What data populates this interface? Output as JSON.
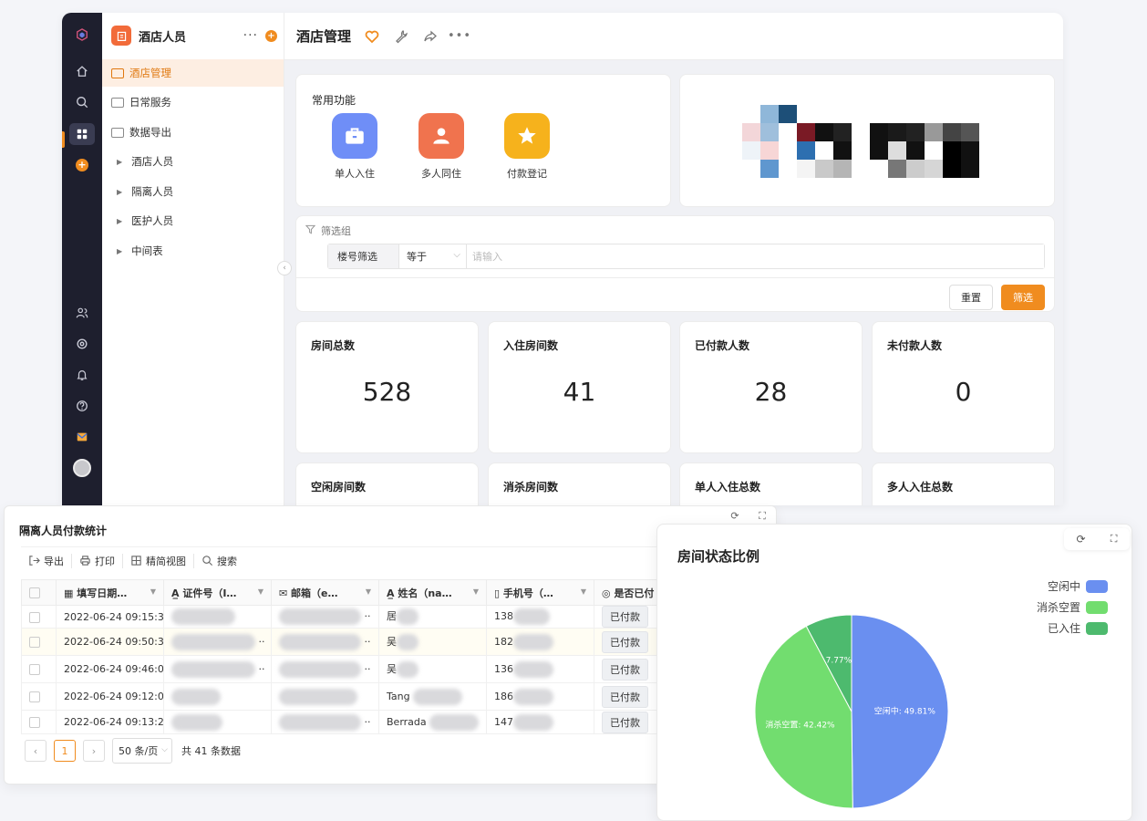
{
  "sidebar": {
    "title": "酒店人员",
    "items": [
      {
        "label": "酒店管理"
      },
      {
        "label": "日常服务"
      },
      {
        "label": "数据导出"
      },
      {
        "label": "酒店人员"
      },
      {
        "label": "隔离人员"
      },
      {
        "label": "医护人员"
      },
      {
        "label": "中间表"
      }
    ]
  },
  "header": {
    "title": "酒店管理"
  },
  "common": {
    "title": "常用功能",
    "items": [
      {
        "label": "单人入住",
        "icon": "briefcase-icon",
        "color": "#6f8ef7"
      },
      {
        "label": "多人同住",
        "icon": "person-icon",
        "color": "#f0734e"
      },
      {
        "label": "付款登记",
        "icon": "star-icon",
        "color": "#f6b21c"
      }
    ]
  },
  "filter": {
    "group_label": "筛选组",
    "field": "楼号筛选",
    "operator": "等于",
    "placeholder": "请输入",
    "reset_label": "重置",
    "submit_label": "筛选"
  },
  "stats": [
    {
      "label": "房间总数",
      "value": "528"
    },
    {
      "label": "入住房间数",
      "value": "41"
    },
    {
      "label": "已付款人数",
      "value": "28"
    },
    {
      "label": "未付款人数",
      "value": "0"
    },
    {
      "label": "空闲房间数",
      "value": ""
    },
    {
      "label": "消杀房间数",
      "value": ""
    },
    {
      "label": "单人入住总数",
      "value": ""
    },
    {
      "label": "多人入住总数",
      "value": ""
    }
  ],
  "table_panel": {
    "title": "隔离人员付款统计",
    "toolbar": [
      "导出",
      "打印",
      "精简视图",
      "搜索"
    ],
    "columns": [
      "填写日期…",
      "证件号（I…",
      "邮箱（e…",
      "姓名（na…",
      "手机号（…",
      "是否已付"
    ],
    "rows": [
      {
        "date": "2022-06-24 09:15:34",
        "name": "居",
        "phone": "138",
        "status": "已付款"
      },
      {
        "date": "2022-06-24 09:50:37",
        "name": "吴",
        "phone": "182",
        "status": "已付款"
      },
      {
        "date": "2022-06-24 09:46:05",
        "name": "吴",
        "phone": "136",
        "status": "已付款"
      },
      {
        "date": "2022-06-24 09:12:06",
        "name": "Tang",
        "phone": "186",
        "status": "已付款"
      },
      {
        "date": "2022-06-24 09:13:21",
        "name": "Berrada",
        "phone": "147",
        "status": "已付款"
      }
    ],
    "pager": {
      "page": "1",
      "size": "50 条/页",
      "total": "共 41 条数据"
    }
  },
  "pie_panel": {
    "title": "房间状态比例",
    "legend": [
      {
        "label": "空闲中",
        "color": "#6a8ff0"
      },
      {
        "label": "消杀空置",
        "color": "#72dd6f"
      },
      {
        "label": "已入住",
        "color": "#4dba6e"
      }
    ]
  },
  "chart_data": {
    "type": "pie",
    "title": "房间状态比例",
    "slices": [
      {
        "label": "空闲中",
        "value": 49.81,
        "color": "#6a8ff0",
        "text": "空闲中: 49.81%"
      },
      {
        "label": "消杀空置",
        "value": 42.42,
        "color": "#72dd6f",
        "text": "消杀空置: 42.42%"
      },
      {
        "label": "已入住",
        "value": 7.77,
        "color": "#4dba6e",
        "text": "7.77%"
      }
    ],
    "legend_position": "top-right"
  }
}
